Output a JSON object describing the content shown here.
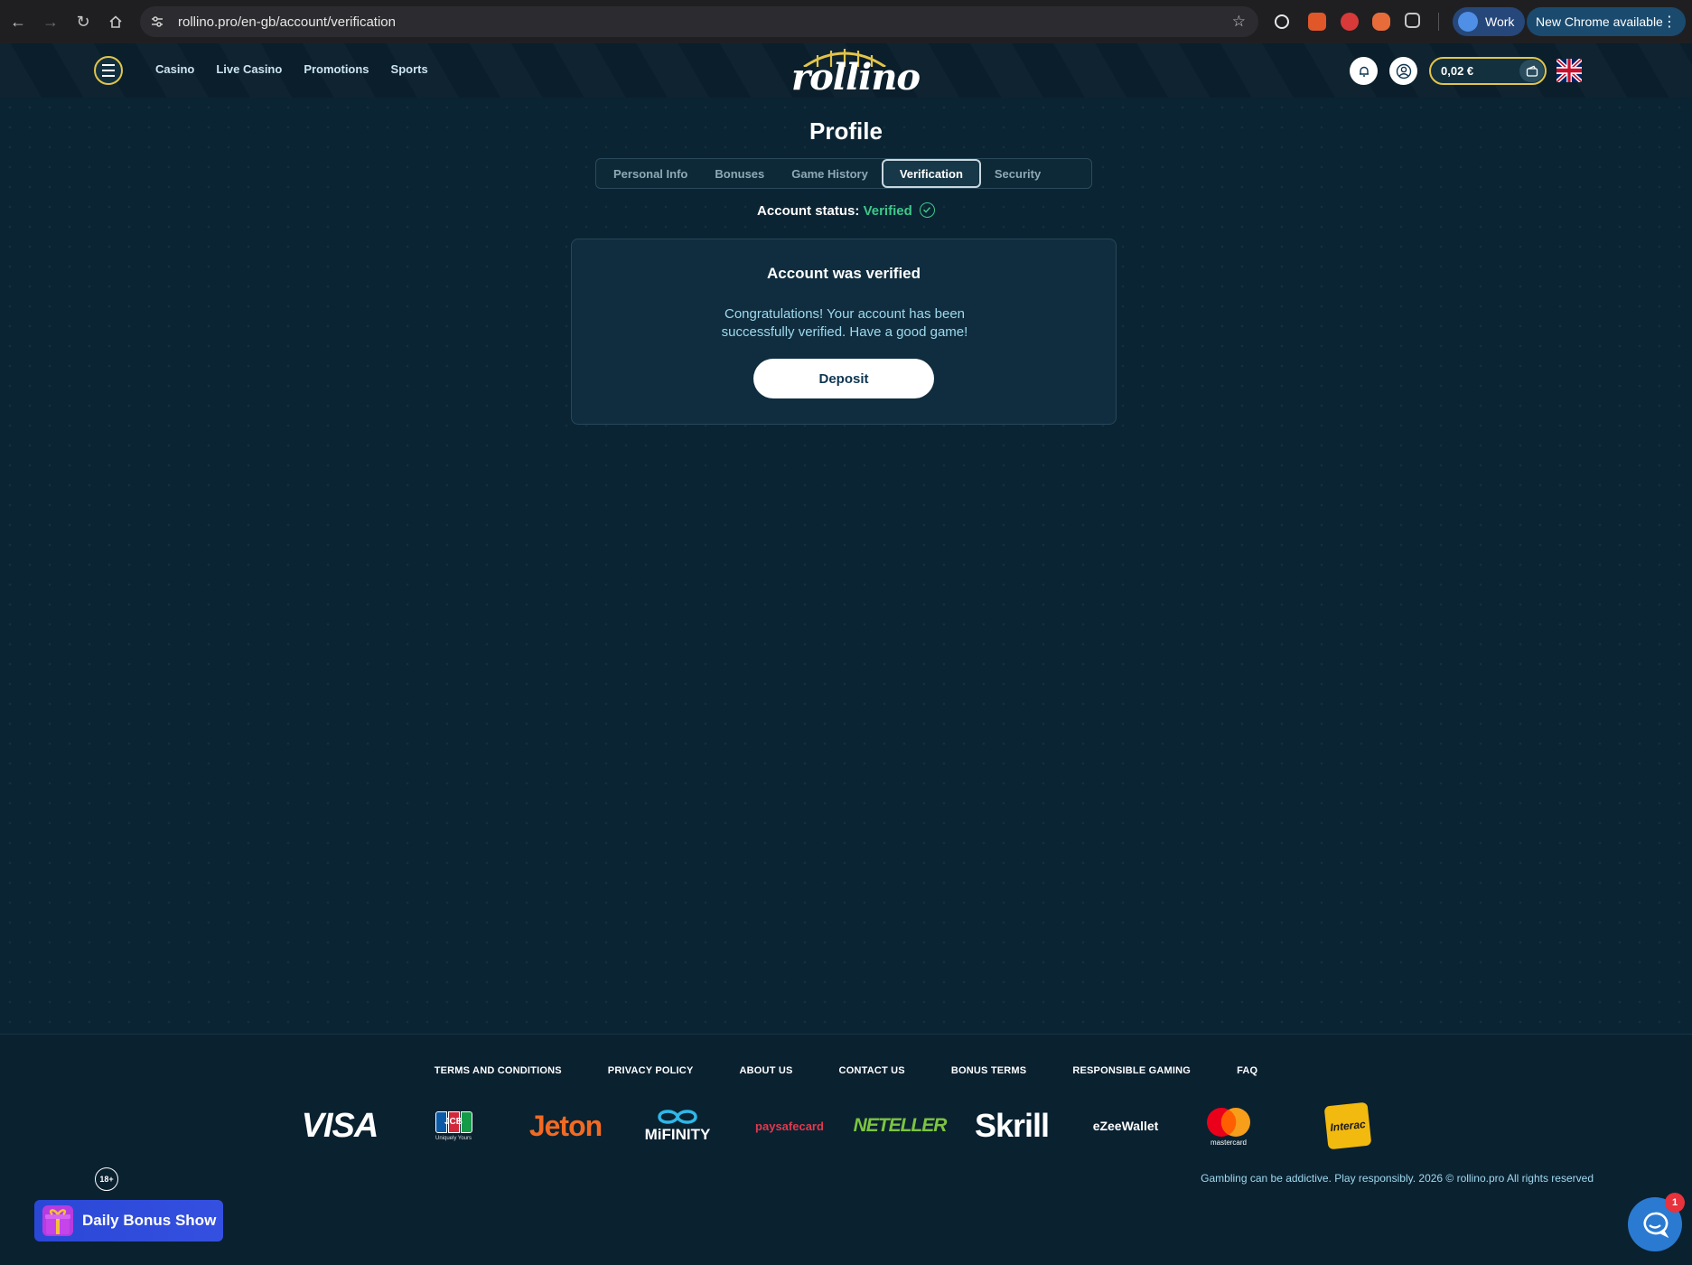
{
  "browser": {
    "url": "rollino.pro/en-gb/account/verification",
    "profile_label": "Work",
    "update_label": "New Chrome available"
  },
  "header": {
    "logo_text": "rollino",
    "nav": [
      "Casino",
      "Live Casino",
      "Promotions",
      "Sports"
    ],
    "balance": "0,02 €",
    "accent_color": "#e2c44a"
  },
  "profile": {
    "title": "Profile",
    "tabs": [
      "Personal Info",
      "Bonuses",
      "Game History",
      "Verification",
      "Security"
    ],
    "active_tab": "Verification",
    "status_label": "Account status:",
    "status_value": "Verified",
    "status_color": "#3fc78a"
  },
  "card": {
    "title": "Account was verified",
    "message": "Congratulations! Your account has been successfully verified. Have a good game!",
    "button": "Deposit"
  },
  "footer": {
    "links": [
      "TERMS AND CONDITIONS",
      "PRIVACY POLICY",
      "ABOUT US",
      "CONTACT US",
      "BONUS TERMS",
      "RESPONSIBLE GAMING",
      "FAQ"
    ],
    "payments": {
      "visa": "VISA",
      "jcb": "JCB",
      "jcb_tagline": "Uniquely Yours",
      "jeton": "Jeton",
      "mifinity": "MiFINITY",
      "paysafecard": "paysafecard",
      "neteller": "NETELLER",
      "skrill": "Skrill",
      "ezeewallet": "eZeeWallet",
      "mastercard": "mastercard",
      "interac": "Interac"
    },
    "copyright": "Gambling can be addictive. Play responsibly. 2026 © rollino.pro All rights reserved",
    "age_badge": "18+"
  },
  "widgets": {
    "daily_bonus": "Daily Bonus Show",
    "chat_unread": "1"
  }
}
